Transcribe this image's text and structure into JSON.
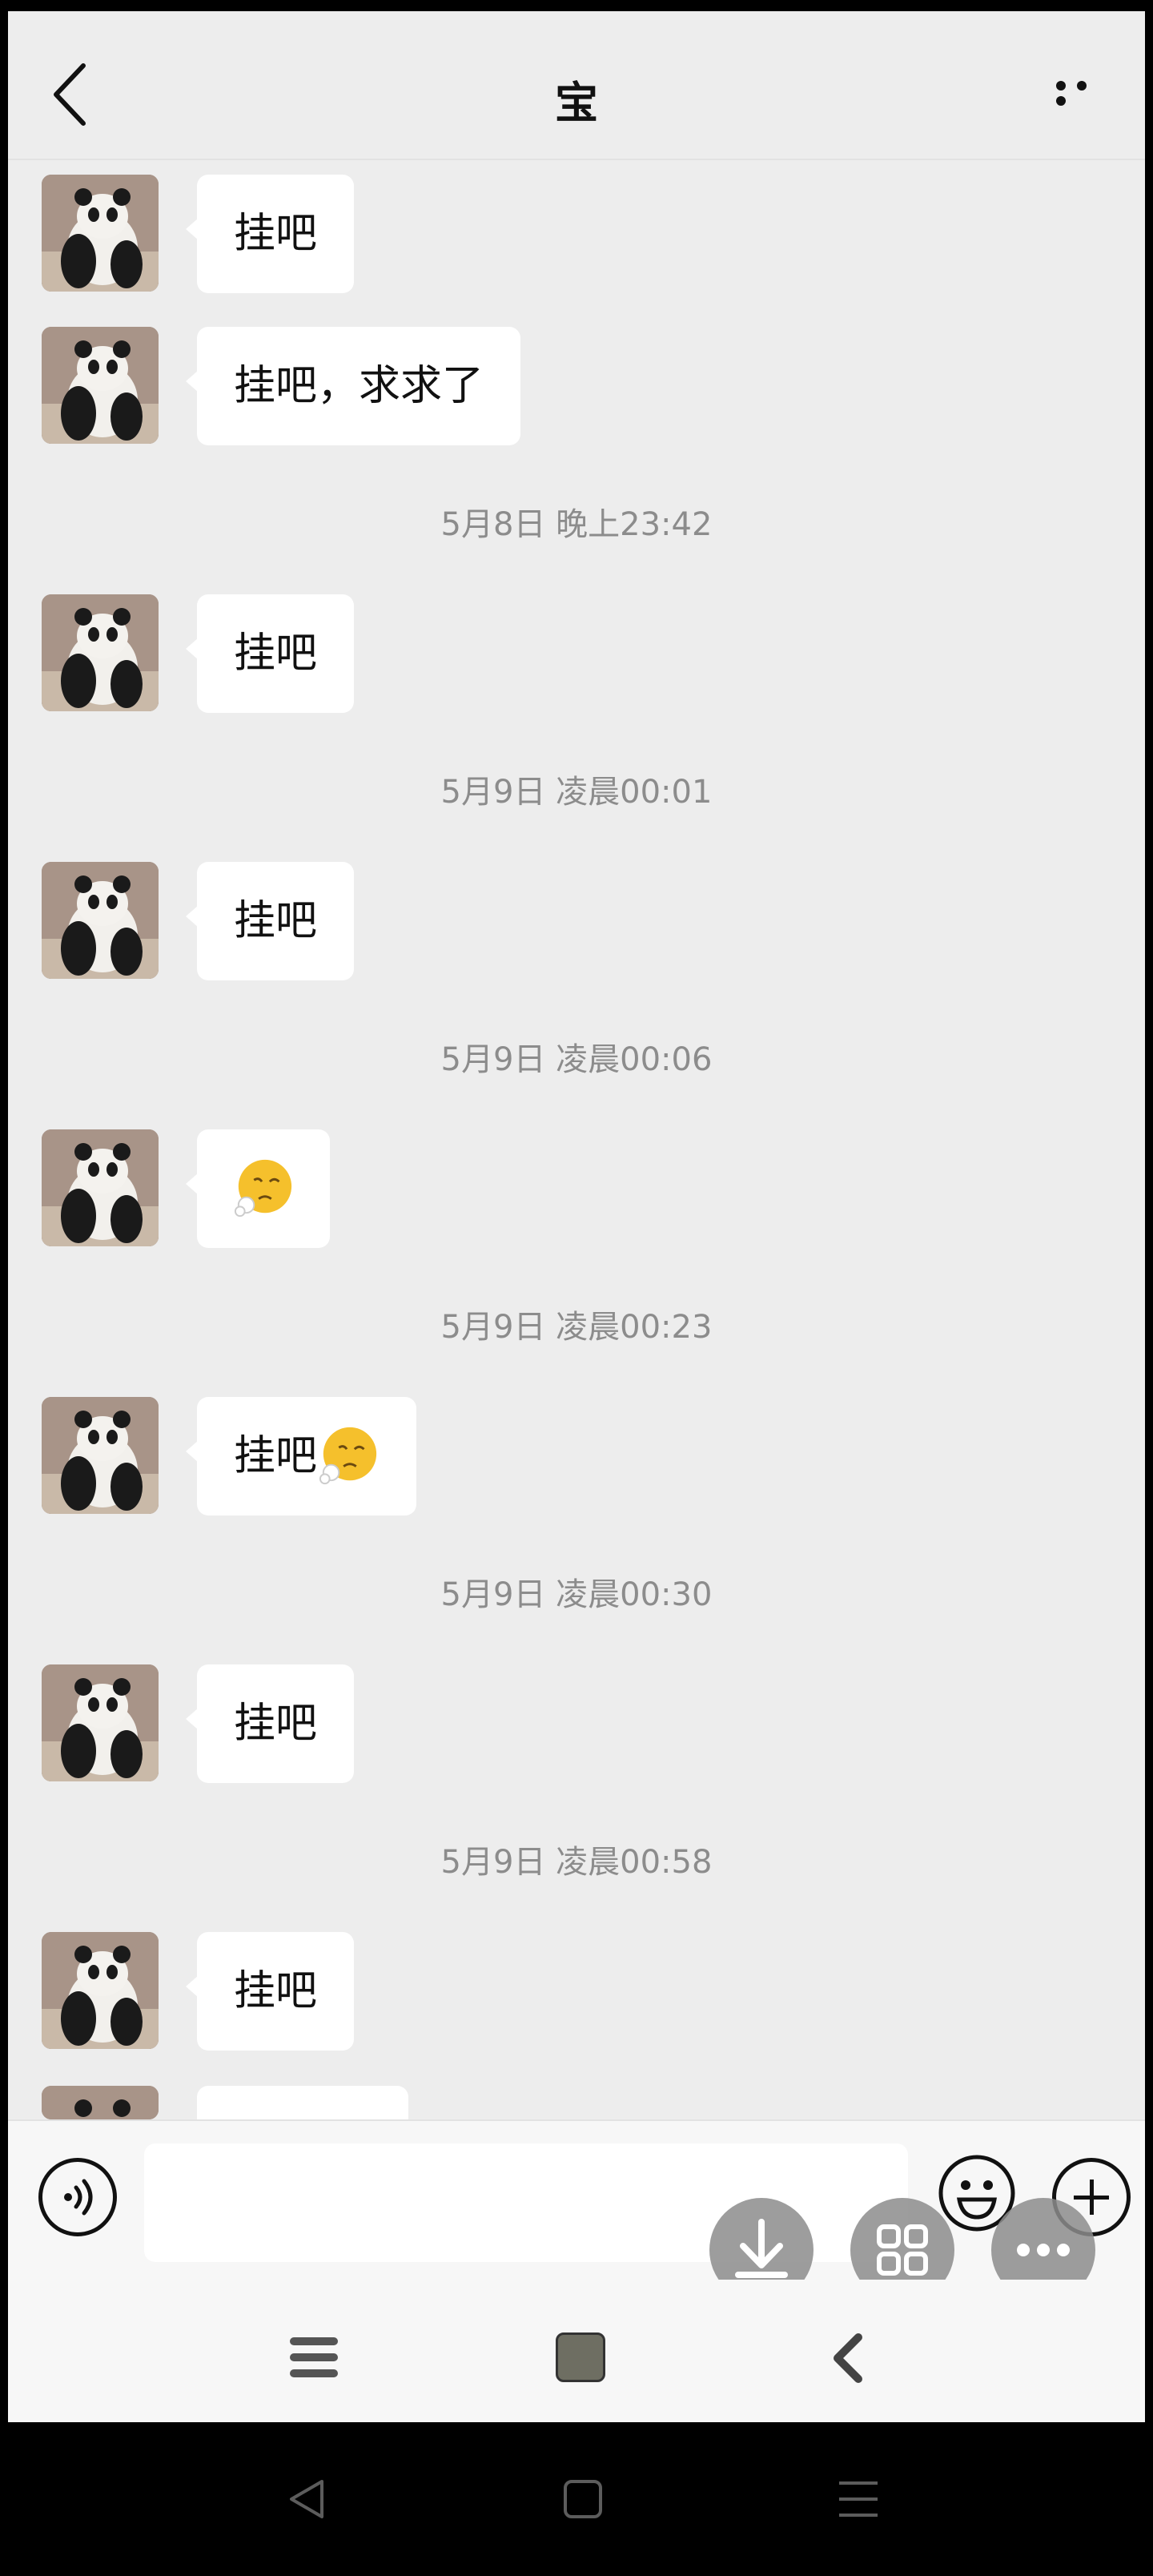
{
  "header": {
    "title": "宝"
  },
  "messages": [
    {
      "kind": "text",
      "text": "挂吧"
    },
    {
      "kind": "text",
      "text": "挂吧，求求了"
    },
    {
      "kind": "time",
      "text": "5月8日 晚上23:42"
    },
    {
      "kind": "text",
      "text": "挂吧"
    },
    {
      "kind": "time",
      "text": "5月9日 凌晨00:01"
    },
    {
      "kind": "text",
      "text": "挂吧"
    },
    {
      "kind": "time",
      "text": "5月9日 凌晨00:06"
    },
    {
      "kind": "emoji",
      "emoji": "sigh-emoji"
    },
    {
      "kind": "time",
      "text": "5月9日 凌晨00:23"
    },
    {
      "kind": "text-emoji",
      "text": "挂吧",
      "emoji": "sigh-emoji"
    },
    {
      "kind": "time",
      "text": "5月9日 凌晨00:30"
    },
    {
      "kind": "text",
      "text": "挂吧"
    },
    {
      "kind": "time",
      "text": "5月9日 凌晨00:58"
    },
    {
      "kind": "text",
      "text": "挂吧"
    }
  ],
  "input_bar": {
    "input_value": ""
  },
  "icons": {
    "back": "back-arrow-icon",
    "more": "more-dots-icon",
    "voice": "voice-icon",
    "emoji": "smiley-icon",
    "plus": "plus-icon",
    "download": "download-icon",
    "grid": "grid-icon",
    "menu": "more-dots-icon"
  },
  "colors": {
    "background": "#ededed",
    "bubble": "#ffffff",
    "timestamp": "#8c8c8c"
  }
}
